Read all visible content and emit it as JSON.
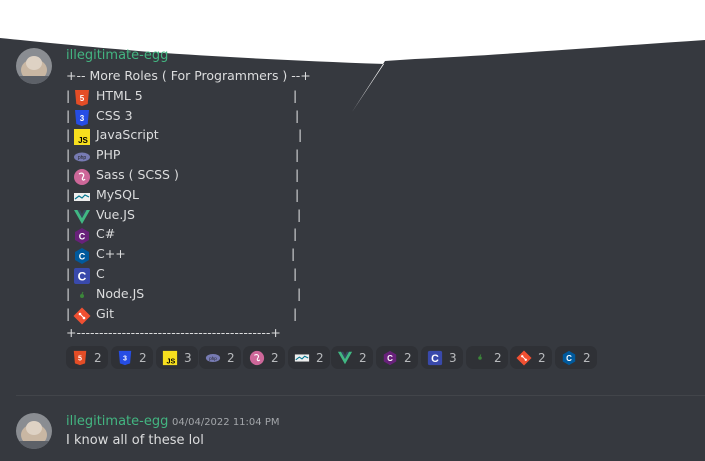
{
  "messages": [
    {
      "username": "illegitimate-egg",
      "timestamp": "",
      "header_line": "+-- More Roles ( For Programmers ) --+",
      "roles": [
        {
          "label": "HTML 5",
          "icon": "html5-icon",
          "color": "#e44d26"
        },
        {
          "label": "CSS 3",
          "icon": "css3-icon",
          "color": "#264de4"
        },
        {
          "label": "JavaScript",
          "icon": "javascript-icon",
          "color": "#f7df1e"
        },
        {
          "label": "PHP",
          "icon": "php-icon",
          "color": "#777bb3"
        },
        {
          "label": "Sass ( SCSS )",
          "icon": "sass-icon",
          "color": "#cd6799"
        },
        {
          "label": "MySQL",
          "icon": "mysql-icon",
          "color": "#00758f"
        },
        {
          "label": "Vue.JS",
          "icon": "vue-icon",
          "color": "#41b883"
        },
        {
          "label": "C#",
          "icon": "csharp-icon",
          "color": "#68217a"
        },
        {
          "label": "C++",
          "icon": "cplusplus-icon",
          "color": "#00599c"
        },
        {
          "label": "C",
          "icon": "c-icon",
          "color": "#3949ab"
        },
        {
          "label": "Node.JS",
          "icon": "nodejs-icon",
          "color": "#3c873a"
        },
        {
          "label": "Git",
          "icon": "git-icon",
          "color": "#f05032"
        }
      ],
      "pipe": "|",
      "footer_line": "+-------------------------------------------+",
      "reactions": [
        {
          "icon": "html5-icon",
          "count": "2"
        },
        {
          "icon": "css3-icon",
          "count": "2"
        },
        {
          "icon": "javascript-icon",
          "count": "3"
        },
        {
          "icon": "php-icon",
          "count": "2"
        },
        {
          "icon": "sass-icon",
          "count": "2"
        },
        {
          "icon": "mysql-icon",
          "count": "2"
        },
        {
          "icon": "vue-icon",
          "count": "2"
        },
        {
          "icon": "csharp-icon",
          "count": "2"
        },
        {
          "icon": "c-icon",
          "count": "3"
        },
        {
          "icon": "nodejs-icon",
          "count": "2"
        },
        {
          "icon": "git-icon",
          "count": "2"
        },
        {
          "icon": "cplusplus-icon",
          "count": "2"
        }
      ]
    },
    {
      "username": "illegitimate-egg",
      "timestamp": "04/04/2022 11:04 PM",
      "text": "I know all of these lol"
    }
  ],
  "colors": {
    "background": "#36393f",
    "username": "#43b581",
    "reaction_bg": "#2f3136",
    "speech_bubble": "#ffffff"
  }
}
